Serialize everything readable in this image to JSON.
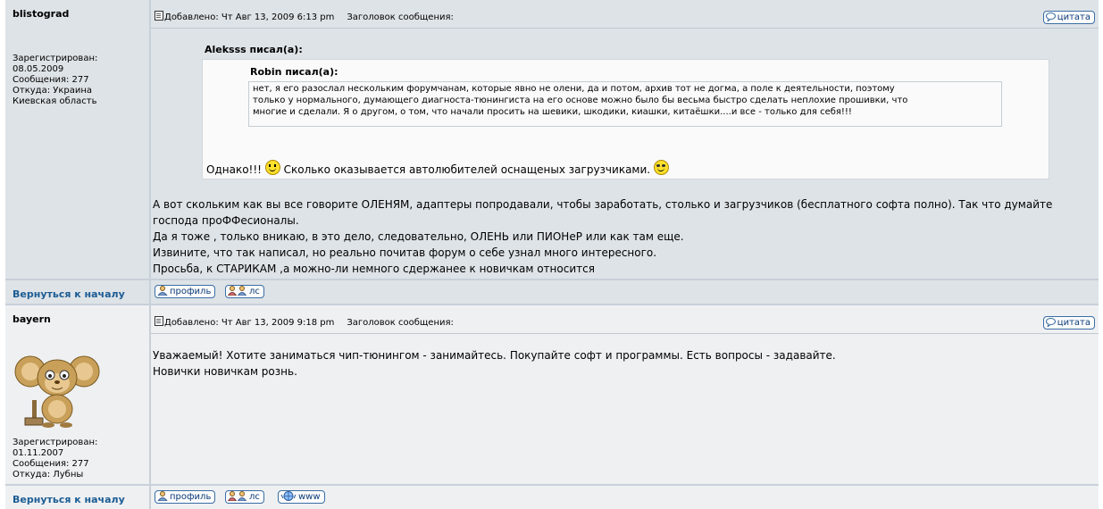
{
  "actions": {
    "quote_label": "цитата",
    "profile_label": "профиль",
    "pm_label": "лс",
    "www_label": "www",
    "back_to_top": "Вернуться к началу"
  },
  "posts": [
    {
      "author": "blistograd",
      "profile": [
        "Зарегистрирован:",
        "08.05.2009",
        "Сообщения: 277",
        "Откуда: Украина",
        "Киевская область"
      ],
      "posted": "Добавлено: Чт Авг 13, 2009 6:13 pm",
      "subject": "Заголовок сообщения:",
      "quote": {
        "author_line": "Aleksss писал(а):",
        "inner_author_line": "Robin писал(а):",
        "inner_lines": [
          "нет, я его разослал нескольким форумчанам, которые явно не олени, да и потом, архив тот не догма, а поле к деятельности, поэтому",
          "только у нормального, думающего диагноста-тюнингиста на его основе можно было бы весьма быстро сделать неплохие прошивки, что",
          "многие и сделали. Я о другом, о том, что начали просить на шевики, шкодики, киашки, китаёшки....и все - только для себя!!!"
        ],
        "reply_before": "Однако!!!",
        "reply_after": "Сколько оказывается автолюбителей оснащеных загрузчиками."
      },
      "body_lines": [
        "А вот скольким как вы все говорите ОЛЕНЯМ, адаптеры попродавали, чтобы заработать, столько и загрузчиков (бесплатного софта полно). Так что думайте",
        "господа проФФесионалы.",
        "Да я тоже , только вникаю, в это дело, следовательно, ОЛЕНЬ или ПИОНеР или как там еще.",
        "Извините, что так написал, но реально почитав форум о себе узнал много интересного.",
        "Просьба, к СТАРИКАМ ,а можно-ли немного сдержанее к новичкам относится"
      ]
    },
    {
      "author": "bayern",
      "profile": [
        "Зарегистрирован:",
        "01.11.2007",
        "Сообщения: 277",
        "Откуда: Лубны"
      ],
      "posted": "Добавлено: Чт Авг 13, 2009 9:18 pm",
      "subject": "Заголовок сообщения:",
      "body_lines": [
        "Уважаемый! Хотите заниматься чип-тюнингом - занимайтесь. Покупайте софт и программы. Есть вопросы - задавайте.",
        "Новички новичкам рознь."
      ]
    }
  ],
  "colors": {
    "row_light": "#eef0f2",
    "row_dark": "#dee3e7",
    "link": "#1c5c94",
    "button_border": "#3a6ea5"
  },
  "icons": [
    "post-icon",
    "quote-icon",
    "profile-icon",
    "pm-icon",
    "www-icon",
    "smile-icon",
    "cool-smile-icon",
    "cheburashka-avatar"
  ]
}
